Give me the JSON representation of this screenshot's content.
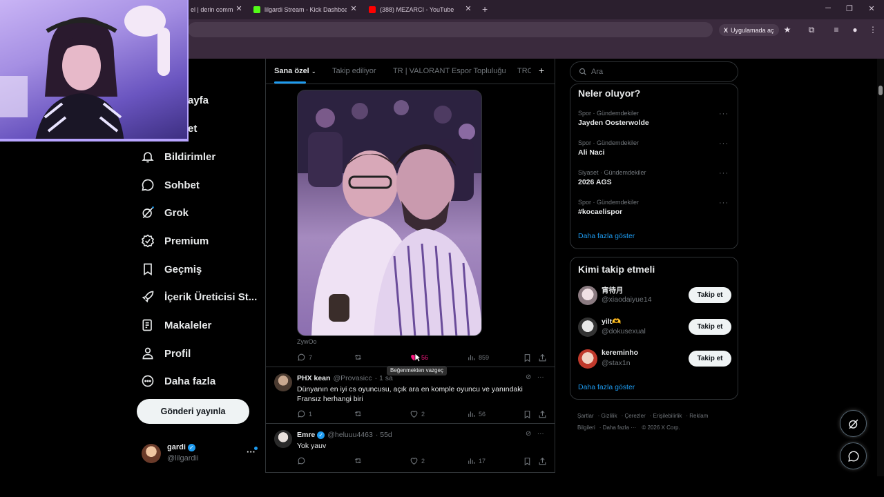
{
  "browser": {
    "tabs": [
      {
        "title": "el | derin commun",
        "color": "#5865f2"
      },
      {
        "title": "lilgardi Stream - Kick Dashboard",
        "color": "#53fc18"
      },
      {
        "title": "(388) MEZARCI - YouTube",
        "color": "#ff0000"
      }
    ],
    "app_open_label": "Uygulamada aç",
    "icons": [
      "bookmark-star-icon",
      "extensions-icon",
      "media-icon",
      "profile-icon",
      "kebab-menu-icon"
    ]
  },
  "nav": {
    "items": [
      {
        "label": "ayfa",
        "icon": "home-icon"
      },
      {
        "label": "et",
        "icon": "explore-icon"
      },
      {
        "label": "Bildirimler",
        "icon": "bell-icon"
      },
      {
        "label": "Sohbet",
        "icon": "chat-icon"
      },
      {
        "label": "Grok",
        "icon": "grok-icon"
      },
      {
        "label": "Premium",
        "icon": "premium-icon"
      },
      {
        "label": "Geçmiş",
        "icon": "bookmark-icon"
      },
      {
        "label": "İçerik Üreticisi St...",
        "icon": "rocket-icon"
      },
      {
        "label": "Makaleler",
        "icon": "article-icon"
      },
      {
        "label": "Profil",
        "icon": "person-icon"
      },
      {
        "label": "Daha fazla",
        "icon": "more-circle-icon"
      }
    ],
    "post_button": "Gönderi yayınla",
    "account": {
      "name": "gardi",
      "handle": "@lilgardii"
    }
  },
  "feed": {
    "tabs": [
      "Sana özel",
      "Takip ediliyor",
      "TR | VALORANT Espor Topluluğu",
      "TRC"
    ],
    "post": {
      "caption": "ZywOo",
      "replies": "7",
      "reposts": "",
      "likes": "56",
      "views": "859",
      "tooltip": "Beğenmekten vazgeç"
    },
    "replies": [
      {
        "name": "PHX kean",
        "handle": "@Provasicc",
        "time": "· 1 sa",
        "verified": false,
        "text": "Dünyanın en iyi cs oyuncusu, açık ara en komple oyuncu ve yanındaki Fransız herhangi biri",
        "replies": "1",
        "reposts": "",
        "likes": "2",
        "views": "56"
      },
      {
        "name": "Emre",
        "handle": "@heluuu4463",
        "time": "· 55d",
        "verified": true,
        "text": "Yok yauv",
        "replies": "",
        "reposts": "",
        "likes": "2",
        "views": "17"
      }
    ]
  },
  "sidebar": {
    "search_placeholder": "Ara",
    "trends_title": "Neler oluyor?",
    "trends": [
      {
        "category": "Spor · Gündemdekiler",
        "name": "Jayden Oosterwolde"
      },
      {
        "category": "Spor · Gündemdekiler",
        "name": "Ali Naci"
      },
      {
        "category": "Siyaset · Gündemdekiler",
        "name": "2026 AGS"
      },
      {
        "category": "Spor · Gündemdekiler",
        "name": "#kocaelispor"
      }
    ],
    "show_more": "Daha fazla göster",
    "who_to_follow_title": "Kimi takip etmeli",
    "who_to_follow": [
      {
        "name": "宵待月",
        "handle": "@xiaodaiyue14",
        "button": "Takip et"
      },
      {
        "name": "yilt🫶",
        "handle": "@dokusexual",
        "button": "Takip et"
      },
      {
        "name": "kereminho",
        "handle": "@stax1n",
        "button": "Takip et"
      }
    ],
    "footer": [
      "Şartlar",
      "Gizlilik",
      "Çerezler",
      "Erişilebilirlik",
      "Reklam Bilgileri",
      "Daha fazla ···",
      "© 2026 X Corp."
    ]
  },
  "colors": {
    "accent": "#1d9bf0",
    "like": "#f91880",
    "bg": "#000000",
    "border": "#2f3336"
  }
}
